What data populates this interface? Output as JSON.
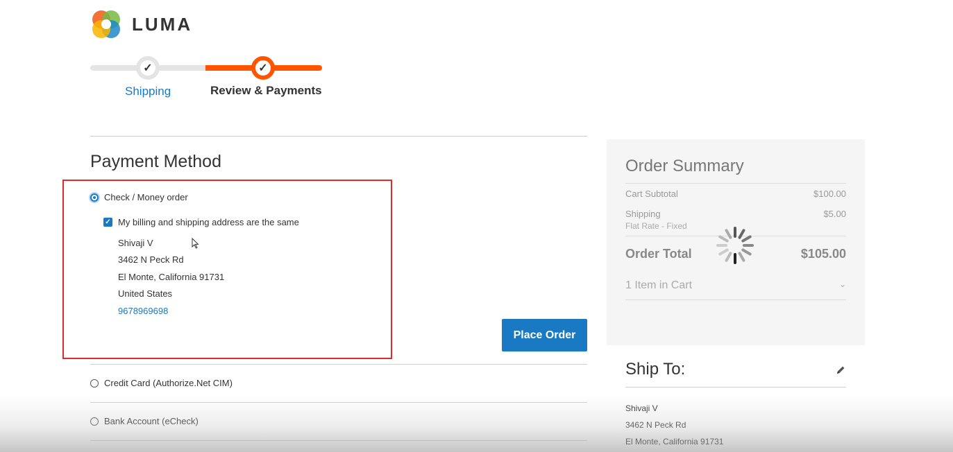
{
  "brand": {
    "name": "LUMA"
  },
  "progress": {
    "steps": [
      {
        "label": "Shipping",
        "status": "complete"
      },
      {
        "label": "Review & Payments",
        "status": "active"
      }
    ]
  },
  "payment": {
    "title": "Payment Method",
    "methods": [
      {
        "label": "Check / Money order",
        "selected": true
      },
      {
        "label": "Credit Card (Authorize.Net CIM)",
        "selected": false
      },
      {
        "label": "Bank Account (eCheck)",
        "selected": false
      }
    ],
    "same_address_label": "My billing and shipping address are the same",
    "same_address_checked": true,
    "billing_address": {
      "name": "Shivaji V",
      "street": "3462 N Peck Rd",
      "city_line": "El Monte, California 91731",
      "country": "United States",
      "phone": "9678969698"
    },
    "place_order_label": "Place Order"
  },
  "order_summary": {
    "title": "Order Summary",
    "cart_subtotal_label": "Cart Subtotal",
    "cart_subtotal_value": "$100.00",
    "shipping_label": "Shipping",
    "shipping_method": "Flat Rate - Fixed",
    "shipping_value": "$5.00",
    "total_label": "Order Total",
    "total_value": "$105.00",
    "items_label": "1 Item in Cart",
    "loading": true
  },
  "ship_to": {
    "title": "Ship To:",
    "name": "Shivaji V",
    "street": "3462 N Peck Rd",
    "city_line": "El Monte, California 91731"
  },
  "colors": {
    "accent": "#1979c3",
    "progress_active": "#ff5501",
    "highlight_box": "#e02b27"
  }
}
